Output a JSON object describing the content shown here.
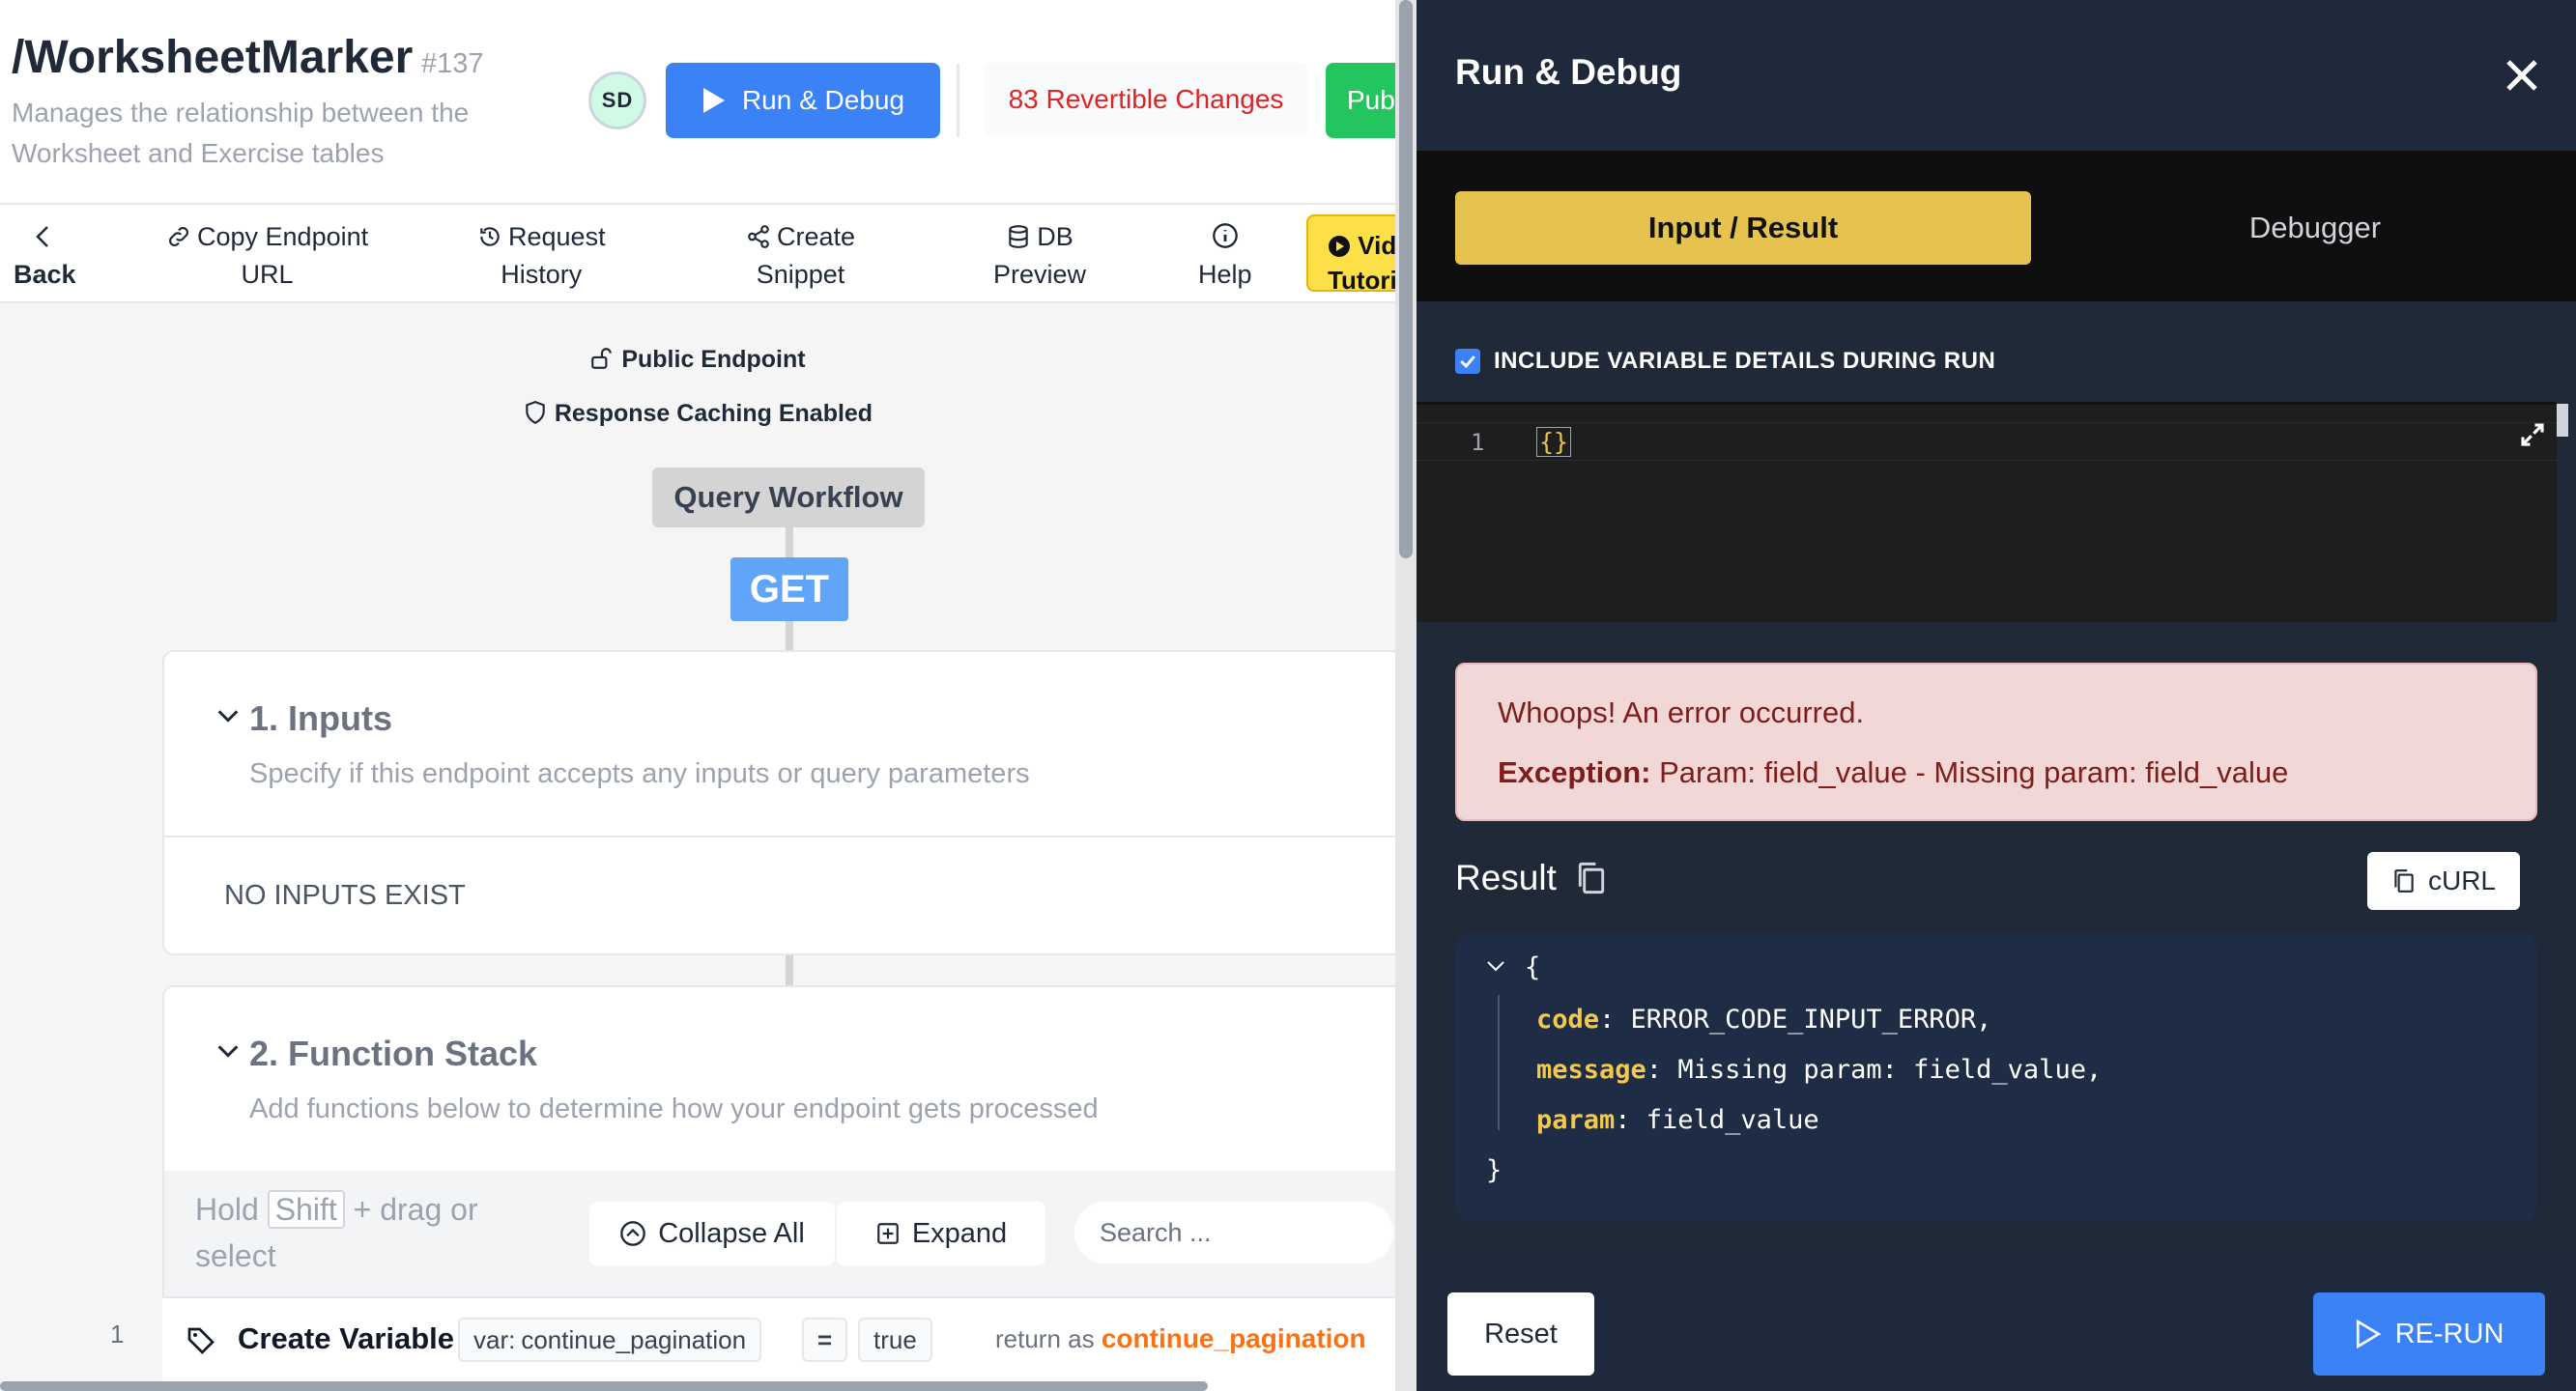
{
  "endpoint": {
    "title": "/WorksheetMarker",
    "id": "#137",
    "description": "Manages the relationship between the Worksheet and Exercise tables",
    "avatar": "SD",
    "run_debug": "Run & Debug",
    "changes": "83 Revertible Changes",
    "publish": "Pub"
  },
  "toolbar": {
    "back": "Back",
    "copy_endpoint": [
      "Copy Endpoint",
      "URL"
    ],
    "request_history": [
      "Request",
      "History"
    ],
    "create_snippet": [
      "Create",
      "Snippet"
    ],
    "db_preview": [
      "DB",
      "Preview"
    ],
    "help": "Help",
    "video": [
      "Vid",
      "Tutori"
    ]
  },
  "flags": {
    "public": "Public Endpoint",
    "caching": "Response Caching Enabled"
  },
  "workflow": {
    "label": "Query Workflow",
    "method": "GET"
  },
  "inputs": {
    "title": "1. Inputs",
    "subtitle": "Specify if this endpoint accepts any inputs or query parameters",
    "empty": "NO INPUTS EXIST"
  },
  "function_stack": {
    "title": "2. Function Stack",
    "subtitle": "Add functions below to determine how your endpoint gets processed",
    "hold": "Hold",
    "shift": "Shift",
    "drag": "+ drag or select",
    "collapse_all": "Collapse All",
    "expand": "Expand",
    "search_placeholder": "Search ...",
    "rows": [
      {
        "num": "1",
        "name": "Create Variable",
        "var_prefix": "var:",
        "var_name": "continue_pagination",
        "op": "=",
        "value": "true",
        "return_label": "return as",
        "return_name": "continue_pagination"
      }
    ]
  },
  "run_panel": {
    "title": "Run & Debug",
    "tabs": {
      "active": "Input / Result",
      "inactive": "Debugger"
    },
    "include_variables": "INCLUDE VARIABLE DETAILS DURING RUN",
    "include_checked": true,
    "editor": {
      "line": "1",
      "code": "{}"
    },
    "error": {
      "title": "Whoops! An error occurred.",
      "label": "Exception:",
      "message": "Param: field_value - Missing param: field_value"
    },
    "result_label": "Result",
    "curl": "cURL",
    "json": {
      "open": "{",
      "close": "}",
      "entries": [
        {
          "key": "code",
          "value": "ERROR_CODE_INPUT_ERROR,"
        },
        {
          "key": "message",
          "value": "Missing param: field_value,"
        },
        {
          "key": "param",
          "value": "field_value"
        }
      ]
    },
    "reset": "Reset",
    "rerun": "RE-RUN"
  },
  "colors": {
    "primary": "#3b82f6",
    "accent_yellow": "#e6c34f",
    "error_bg": "#f2d7d7",
    "panel_dark": "#1e293b",
    "return_orange": "#f97316"
  }
}
